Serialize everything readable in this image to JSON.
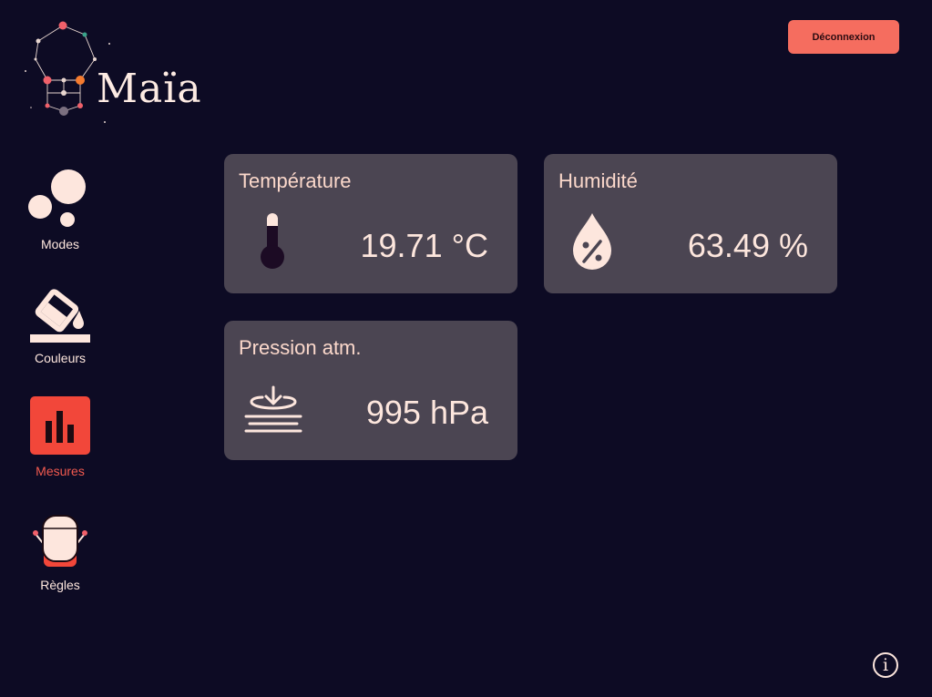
{
  "app": {
    "name": "Maïa"
  },
  "header": {
    "logout_label": "Déconnexion"
  },
  "sidebar": {
    "items": [
      {
        "label": "Modes",
        "icon": "bubbles-icon",
        "active": false
      },
      {
        "label": "Couleurs",
        "icon": "paint-bucket-icon",
        "active": false
      },
      {
        "label": "Mesures",
        "icon": "bar-chart-icon",
        "active": true
      },
      {
        "label": "Règles",
        "icon": "robot-icon",
        "active": false
      }
    ]
  },
  "cards": [
    {
      "title": "Température",
      "value": "19.71 °C",
      "icon": "thermometer-icon"
    },
    {
      "title": "Humidité",
      "value": "63.49 %",
      "icon": "humidity-drop-icon"
    },
    {
      "title": "Pression atm.",
      "value": "995 hPa",
      "icon": "pressure-icon"
    }
  ],
  "footer": {
    "info_label": "i"
  },
  "colors": {
    "background": "#0d0b24",
    "card": "#4b4552",
    "accent": "#f56d5f",
    "active": "#f25a4f",
    "text": "#fde6dd"
  }
}
